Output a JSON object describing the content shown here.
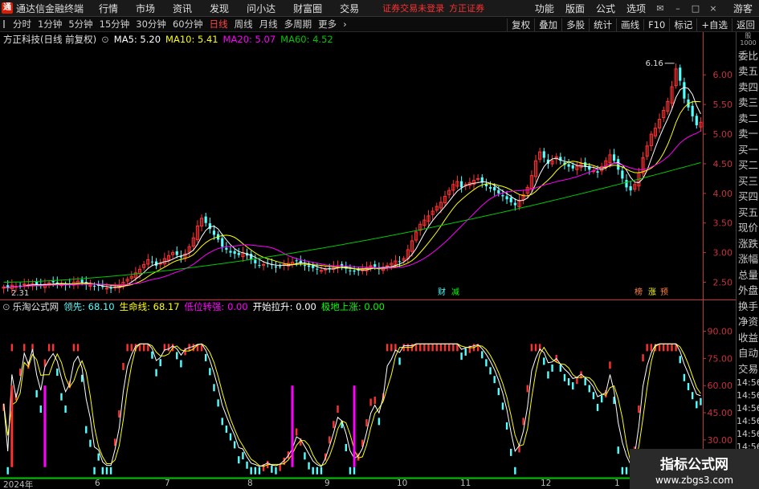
{
  "titlebar": {
    "app_title": "通达信金融终端",
    "menu": [
      "行情",
      "市场",
      "资讯",
      "发现",
      "问小达",
      "财富圈",
      "交易"
    ],
    "notice": "证券交易未登录",
    "broker": "方正证券",
    "right_menu": [
      "功能",
      "版面",
      "公式",
      "选项"
    ],
    "guest": "游客"
  },
  "periodbar": {
    "periods": [
      "分时",
      "1分钟",
      "5分钟",
      "15分钟",
      "30分钟",
      "60分钟",
      "日线",
      "周线",
      "月线",
      "多周期",
      "更多"
    ],
    "active": "日线",
    "tools": [
      "复权",
      "叠加",
      "多股",
      "统计",
      "画线",
      "F10",
      "标记",
      "+自选",
      "返回"
    ]
  },
  "info": {
    "stock_name": "方正科技(日线 前复权)",
    "ma5": "MA5: 5.20",
    "ma10": "MA10: 5.41",
    "ma20": "MA20: 5.07",
    "ma60": "MA60: 4.52"
  },
  "colors": {
    "up": "#ff3232",
    "down": "#54ffff",
    "ma5": "#ffffff",
    "ma10": "#ffff00",
    "ma20": "#ff00ff",
    "ma60": "#00c800",
    "axis": "#c8323c"
  },
  "main_axis": {
    "ticks": [
      "6.00",
      "5.50",
      "5.00",
      "4.50",
      "4.00",
      "3.50",
      "3.00",
      "2.50"
    ],
    "high_label": "6.16",
    "low_label": "2.31"
  },
  "markers": [
    "财",
    "减",
    "榜",
    "涨",
    "预"
  ],
  "right_panel": {
    "top_label": "股\n1000",
    "items": [
      "委比",
      "卖五",
      "卖四",
      "卖三",
      "卖二",
      "卖一",
      "买一",
      "买二",
      "买三",
      "买四",
      "买五",
      "现价",
      "涨跌",
      "涨幅",
      "总量",
      "外盘",
      "换手",
      "净资",
      "收益",
      "自动",
      "交易"
    ],
    "times": [
      "14:56",
      "14:56",
      "14:56",
      "14:56",
      "14:56",
      "14:56",
      "14:56",
      "14:56"
    ]
  },
  "sub_indicator": {
    "name": "乐淘公式网",
    "lead": "领先: 68.10",
    "life": "生命线: 68.17",
    "turn": "低位转强: 0.00",
    "rise": "开始拉升: 0.00",
    "bottom": "极地上涨: 0.00"
  },
  "sub_axis": {
    "ticks": [
      "90.00",
      "75.00",
      "60.00",
      "45.00",
      "30.00",
      "15.00"
    ]
  },
  "xaxis": [
    "2024年",
    "6",
    "7",
    "8",
    "9",
    "10",
    "11",
    "12",
    "1"
  ],
  "watermark": {
    "title": "指标公式网",
    "url": "www.zbgs3.com"
  },
  "chart_data": {
    "type": "candlestick",
    "closes": [
      2.42,
      2.4,
      2.45,
      2.43,
      2.44,
      2.47,
      2.46,
      2.48,
      2.45,
      2.44,
      2.47,
      2.49,
      2.5,
      2.48,
      2.46,
      2.45,
      2.47,
      2.5,
      2.52,
      2.49,
      2.46,
      2.45,
      2.43,
      2.44,
      2.42,
      2.4,
      2.39,
      2.42,
      2.45,
      2.5,
      2.55,
      2.6,
      2.66,
      2.72,
      2.8,
      2.88,
      2.85,
      2.78,
      2.82,
      2.9,
      2.95,
      3.0,
      2.96,
      2.92,
      2.98,
      3.1,
      3.25,
      3.45,
      3.58,
      3.5,
      3.4,
      3.3,
      3.22,
      3.1,
      3.05,
      3.0,
      2.98,
      2.96,
      3.0,
      2.95,
      2.88,
      2.82,
      2.78,
      2.8,
      2.82,
      2.79,
      2.75,
      2.77,
      2.8,
      2.82,
      2.84,
      2.86,
      2.82,
      2.78,
      2.76,
      2.74,
      2.72,
      2.7,
      2.72,
      2.74,
      2.76,
      2.78,
      2.76,
      2.73,
      2.7,
      2.68,
      2.7,
      2.72,
      2.75,
      2.78,
      2.76,
      2.72,
      2.74,
      2.78,
      2.82,
      2.86,
      2.84,
      2.9,
      3.05,
      3.2,
      3.35,
      3.48,
      3.55,
      3.62,
      3.7,
      3.78,
      3.85,
      3.95,
      4.05,
      4.15,
      4.2,
      4.1,
      4.15,
      4.18,
      4.22,
      4.25,
      4.18,
      4.12,
      4.08,
      4.05,
      4.0,
      3.95,
      3.9,
      3.85,
      3.8,
      3.88,
      3.98,
      4.1,
      4.3,
      4.55,
      4.7,
      4.6,
      4.5,
      4.55,
      4.62,
      4.55,
      4.48,
      4.45,
      4.42,
      4.46,
      4.5,
      4.45,
      4.4,
      4.38,
      4.35,
      4.45,
      4.55,
      4.65,
      4.55,
      4.4,
      4.25,
      4.1,
      4.05,
      4.15,
      4.35,
      4.6,
      4.8,
      5.0,
      5.1,
      5.25,
      5.4,
      5.55,
      5.8,
      6.1,
      5.9,
      5.6,
      5.45,
      5.3,
      5.15,
      5.2
    ],
    "ma60_start": 2.5,
    "ma60_end": 4.52,
    "ylim": [
      2.25,
      6.45
    ],
    "sub_ylim": [
      10,
      100
    ]
  }
}
